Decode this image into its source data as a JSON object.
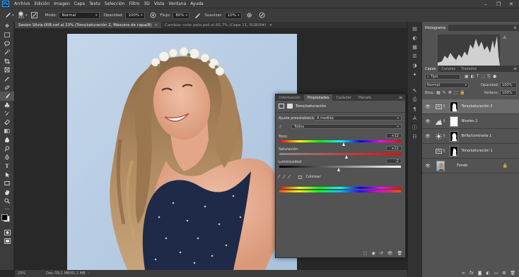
{
  "app": {
    "logo_text": "Ps",
    "menu": [
      "Archivo",
      "Edición",
      "Imagen",
      "Capa",
      "Texto",
      "Selección",
      "Filtro",
      "3D",
      "Vista",
      "Ventana",
      "Ayuda"
    ],
    "window_controls": [
      "–",
      "❐",
      "✕"
    ]
  },
  "options_bar": {
    "brush_size": "205",
    "mode_label": "Modo:",
    "mode_value": "Normal",
    "opacity_label": "Opacidad:",
    "opacity_value": "100%",
    "flow_label": "Flujo:",
    "flow_value": "80%",
    "smoothing_label": "Suavizar:",
    "smoothing_value": "10%"
  },
  "tools": [
    "move",
    "marquee",
    "lasso",
    "quick-select",
    "crop",
    "frame",
    "eyedropper",
    "healing",
    "brush",
    "stamp",
    "history-brush",
    "eraser",
    "gradient",
    "blur",
    "dodge",
    "pen",
    "type",
    "path-select",
    "rectangle",
    "hand",
    "zoom",
    "more",
    "colors",
    "quick-mask",
    "screen-mode"
  ],
  "doc_tabs": [
    {
      "label": "Sesion Silvia-008.nef al 23% (Tono/saturación 2, Máscara de capa/8)",
      "close": "×",
      "active": true
    },
    {
      "label": "Cambiar color pelo.psd al 66,7% (Capa 11, RGB/8#)",
      "close": "×",
      "active": false
    }
  ],
  "status": {
    "zoom": "23%",
    "doc": "Doc: 59,1 MB/81,1 MB",
    "arrow": "›"
  },
  "properties": {
    "tabs": [
      "Información",
      "Propiedades",
      "Carácter",
      "Párrafo"
    ],
    "header": "Tono/saturación",
    "preset_label": "Ajuste preestablecido:",
    "preset_value": "A medida",
    "channel_value": "Todos",
    "hue_label": "Tono:",
    "hue_value": "+12",
    "sat_label": "Saturación:",
    "sat_value": "+11",
    "light_label": "Luminosidad:",
    "light_value": "-2",
    "colorize_label": "Colorear",
    "hue_fraction": 0.533,
    "sat_fraction": 0.555,
    "light_fraction": 0.49
  },
  "histogram": {
    "tab": "Histograma"
  },
  "layers_panel": {
    "tabs": [
      "Capas",
      "Canales",
      "Trazados"
    ],
    "filter_label": "Tipo",
    "blend_mode": "Normal",
    "opacity_label": "Opacidad:",
    "opacity_value": "100%",
    "lock_label": "Bloq.:",
    "fill_label": "Relleno:",
    "fill_value": "100%",
    "layers": [
      {
        "name": "Tono/saturación 2",
        "visible": true,
        "selected": true,
        "icon": "huesat-icon"
      },
      {
        "name": "Niveles 1",
        "visible": true,
        "selected": false,
        "icon": "levels-icon"
      },
      {
        "name": "Brillo/contraste 1",
        "visible": true,
        "selected": false,
        "icon": "brightness-icon"
      },
      {
        "name": "Tono/saturación 1",
        "visible": false,
        "selected": false,
        "icon": "huesat-icon"
      },
      {
        "name": "Fondo",
        "visible": true,
        "selected": false,
        "icon": "photo-thumb"
      }
    ]
  },
  "colors": {
    "accent": "#31a8ff",
    "panel_bg": "#535353",
    "dark_bg": "#282828"
  }
}
